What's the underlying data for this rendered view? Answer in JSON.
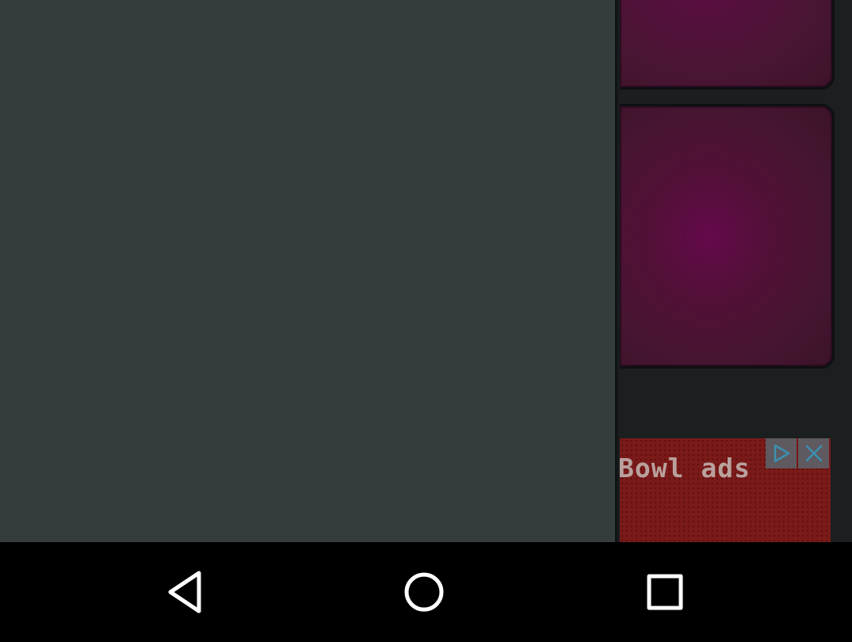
{
  "drawer": {
    "state": "open"
  },
  "app": {
    "pads": [
      {
        "color": "#5a0d42"
      },
      {
        "color": "#640a4b"
      }
    ]
  },
  "ad": {
    "text": "Bowl ads",
    "background_color": "#7a1a19",
    "adchoices_icon": "play-triangle-icon",
    "close_icon": "close-x-icon"
  },
  "navbar": {
    "back_icon": "back-triangle-icon",
    "home_icon": "home-circle-icon",
    "recents_icon": "recents-square-icon"
  },
  "colors": {
    "drawer_bg": "#343c3c",
    "app_bg": "#1b1f20",
    "navbar_bg": "#000000",
    "nav_icon": "#ffffff"
  }
}
